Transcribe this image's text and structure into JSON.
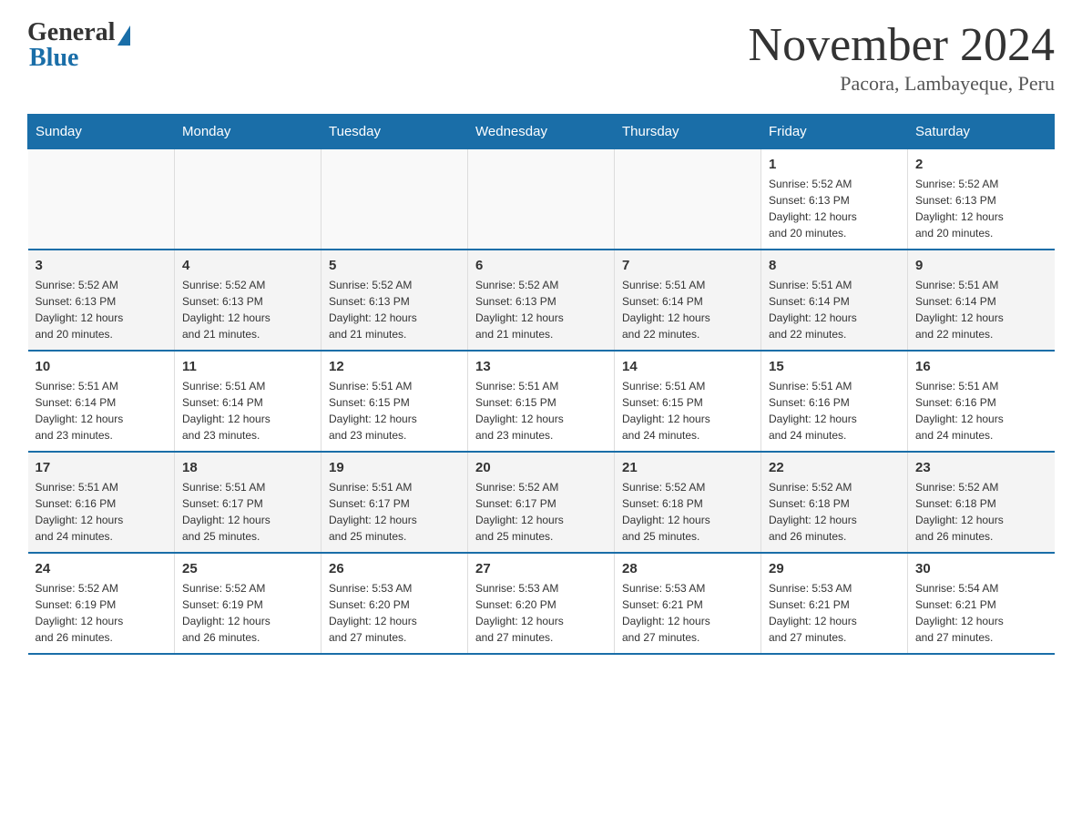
{
  "logo": {
    "general": "General",
    "blue": "Blue"
  },
  "header": {
    "month_title": "November 2024",
    "location": "Pacora, Lambayeque, Peru"
  },
  "weekdays": [
    "Sunday",
    "Monday",
    "Tuesday",
    "Wednesday",
    "Thursday",
    "Friday",
    "Saturday"
  ],
  "weeks": [
    [
      {
        "day": "",
        "info": ""
      },
      {
        "day": "",
        "info": ""
      },
      {
        "day": "",
        "info": ""
      },
      {
        "day": "",
        "info": ""
      },
      {
        "day": "",
        "info": ""
      },
      {
        "day": "1",
        "info": "Sunrise: 5:52 AM\nSunset: 6:13 PM\nDaylight: 12 hours\nand 20 minutes."
      },
      {
        "day": "2",
        "info": "Sunrise: 5:52 AM\nSunset: 6:13 PM\nDaylight: 12 hours\nand 20 minutes."
      }
    ],
    [
      {
        "day": "3",
        "info": "Sunrise: 5:52 AM\nSunset: 6:13 PM\nDaylight: 12 hours\nand 20 minutes."
      },
      {
        "day": "4",
        "info": "Sunrise: 5:52 AM\nSunset: 6:13 PM\nDaylight: 12 hours\nand 21 minutes."
      },
      {
        "day": "5",
        "info": "Sunrise: 5:52 AM\nSunset: 6:13 PM\nDaylight: 12 hours\nand 21 minutes."
      },
      {
        "day": "6",
        "info": "Sunrise: 5:52 AM\nSunset: 6:13 PM\nDaylight: 12 hours\nand 21 minutes."
      },
      {
        "day": "7",
        "info": "Sunrise: 5:51 AM\nSunset: 6:14 PM\nDaylight: 12 hours\nand 22 minutes."
      },
      {
        "day": "8",
        "info": "Sunrise: 5:51 AM\nSunset: 6:14 PM\nDaylight: 12 hours\nand 22 minutes."
      },
      {
        "day": "9",
        "info": "Sunrise: 5:51 AM\nSunset: 6:14 PM\nDaylight: 12 hours\nand 22 minutes."
      }
    ],
    [
      {
        "day": "10",
        "info": "Sunrise: 5:51 AM\nSunset: 6:14 PM\nDaylight: 12 hours\nand 23 minutes."
      },
      {
        "day": "11",
        "info": "Sunrise: 5:51 AM\nSunset: 6:14 PM\nDaylight: 12 hours\nand 23 minutes."
      },
      {
        "day": "12",
        "info": "Sunrise: 5:51 AM\nSunset: 6:15 PM\nDaylight: 12 hours\nand 23 minutes."
      },
      {
        "day": "13",
        "info": "Sunrise: 5:51 AM\nSunset: 6:15 PM\nDaylight: 12 hours\nand 23 minutes."
      },
      {
        "day": "14",
        "info": "Sunrise: 5:51 AM\nSunset: 6:15 PM\nDaylight: 12 hours\nand 24 minutes."
      },
      {
        "day": "15",
        "info": "Sunrise: 5:51 AM\nSunset: 6:16 PM\nDaylight: 12 hours\nand 24 minutes."
      },
      {
        "day": "16",
        "info": "Sunrise: 5:51 AM\nSunset: 6:16 PM\nDaylight: 12 hours\nand 24 minutes."
      }
    ],
    [
      {
        "day": "17",
        "info": "Sunrise: 5:51 AM\nSunset: 6:16 PM\nDaylight: 12 hours\nand 24 minutes."
      },
      {
        "day": "18",
        "info": "Sunrise: 5:51 AM\nSunset: 6:17 PM\nDaylight: 12 hours\nand 25 minutes."
      },
      {
        "day": "19",
        "info": "Sunrise: 5:51 AM\nSunset: 6:17 PM\nDaylight: 12 hours\nand 25 minutes."
      },
      {
        "day": "20",
        "info": "Sunrise: 5:52 AM\nSunset: 6:17 PM\nDaylight: 12 hours\nand 25 minutes."
      },
      {
        "day": "21",
        "info": "Sunrise: 5:52 AM\nSunset: 6:18 PM\nDaylight: 12 hours\nand 25 minutes."
      },
      {
        "day": "22",
        "info": "Sunrise: 5:52 AM\nSunset: 6:18 PM\nDaylight: 12 hours\nand 26 minutes."
      },
      {
        "day": "23",
        "info": "Sunrise: 5:52 AM\nSunset: 6:18 PM\nDaylight: 12 hours\nand 26 minutes."
      }
    ],
    [
      {
        "day": "24",
        "info": "Sunrise: 5:52 AM\nSunset: 6:19 PM\nDaylight: 12 hours\nand 26 minutes."
      },
      {
        "day": "25",
        "info": "Sunrise: 5:52 AM\nSunset: 6:19 PM\nDaylight: 12 hours\nand 26 minutes."
      },
      {
        "day": "26",
        "info": "Sunrise: 5:53 AM\nSunset: 6:20 PM\nDaylight: 12 hours\nand 27 minutes."
      },
      {
        "day": "27",
        "info": "Sunrise: 5:53 AM\nSunset: 6:20 PM\nDaylight: 12 hours\nand 27 minutes."
      },
      {
        "day": "28",
        "info": "Sunrise: 5:53 AM\nSunset: 6:21 PM\nDaylight: 12 hours\nand 27 minutes."
      },
      {
        "day": "29",
        "info": "Sunrise: 5:53 AM\nSunset: 6:21 PM\nDaylight: 12 hours\nand 27 minutes."
      },
      {
        "day": "30",
        "info": "Sunrise: 5:54 AM\nSunset: 6:21 PM\nDaylight: 12 hours\nand 27 minutes."
      }
    ]
  ]
}
